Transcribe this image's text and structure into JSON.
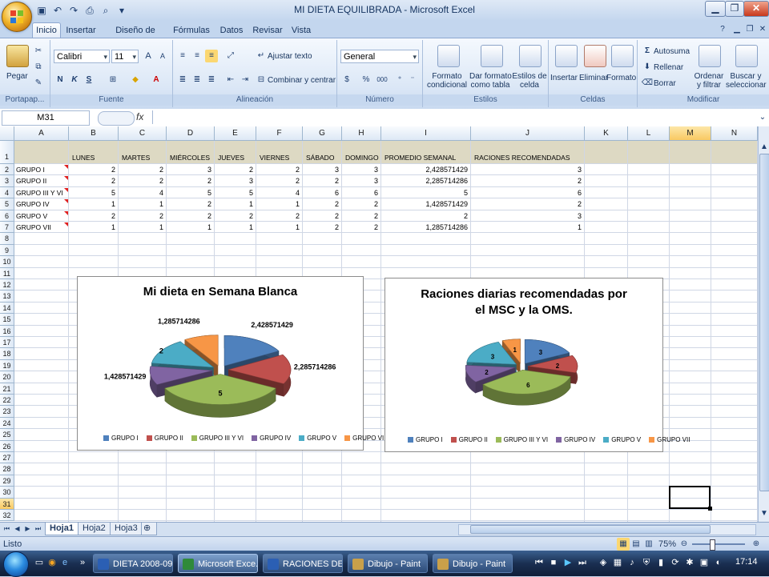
{
  "window": {
    "title": "MI DIETA EQUILIBRADA - Microsoft Excel",
    "controls": {
      "minimize": "▁",
      "maximize": "❐",
      "close": "✕"
    }
  },
  "ribbon_tabs": [
    "Inicio",
    "Insertar",
    "Diseño de página",
    "Fórmulas",
    "Datos",
    "Revisar",
    "Vista"
  ],
  "ribbon": {
    "clipboard": {
      "label": "Portapap...",
      "paste": "Pegar"
    },
    "font": {
      "label": "Fuente",
      "name": "Calibri",
      "size": "11",
      "bold": "N",
      "italic": "K",
      "underline": "S"
    },
    "alignment": {
      "label": "Alineación",
      "wrap": "Ajustar texto",
      "merge": "Combinar y centrar"
    },
    "number": {
      "label": "Número",
      "format": "General",
      "percent": "%",
      "thousands": "000"
    },
    "styles": {
      "label": "Estilos",
      "conditional": [
        "Formato",
        "condicional"
      ],
      "as_table": [
        "Dar formato",
        "como tabla"
      ],
      "cell_styles": [
        "Estilos de",
        "celda"
      ]
    },
    "cells": {
      "label": "Celdas",
      "insert": "Insertar",
      "delete": "Eliminar",
      "format": "Formato"
    },
    "editing": {
      "label": "Modificar",
      "autosum": "Autosuma",
      "fill": "Rellenar",
      "clear": "Borrar",
      "sort": [
        "Ordenar",
        "y filtrar"
      ],
      "find": [
        "Buscar y",
        "seleccionar"
      ]
    }
  },
  "formula_bar": {
    "name_box": "M31",
    "fx": "fx",
    "formula": ""
  },
  "columns": [
    "A",
    "B",
    "C",
    "D",
    "E",
    "F",
    "G",
    "H",
    "I",
    "J",
    "K",
    "L",
    "M",
    "N"
  ],
  "selected_column": "M",
  "selected_row": 31,
  "rows": [
    "1",
    "2",
    "3",
    "4",
    "5",
    "6",
    "7",
    "8",
    "9",
    "10",
    "11",
    "12",
    "13",
    "14",
    "15",
    "16",
    "17",
    "18",
    "19",
    "20",
    "21",
    "22",
    "23",
    "24",
    "25",
    "26",
    "27",
    "28",
    "29",
    "30",
    "31",
    "32"
  ],
  "table": {
    "headers": [
      "",
      "LUNES",
      "MARTES",
      "MIÉRCOLES",
      "JUEVES",
      "VIERNES",
      "SÁBADO",
      "DOMINGO",
      "PROMEDIO SEMANAL",
      "RACIONES RECOMENDADAS"
    ],
    "rows": [
      [
        "GRUPO I",
        "2",
        "2",
        "3",
        "2",
        "2",
        "3",
        "3",
        "2,428571429",
        "3"
      ],
      [
        "GRUPO II",
        "2",
        "2",
        "2",
        "3",
        "2",
        "2",
        "3",
        "2,285714286",
        "2"
      ],
      [
        "GRUPO III Y VI",
        "5",
        "4",
        "5",
        "5",
        "4",
        "6",
        "6",
        "5",
        "6"
      ],
      [
        "GRUPO IV",
        "1",
        "1",
        "2",
        "1",
        "1",
        "2",
        "2",
        "1,428571429",
        "2"
      ],
      [
        "GRUPO V",
        "2",
        "2",
        "2",
        "2",
        "2",
        "2",
        "2",
        "2",
        "3"
      ],
      [
        "GRUPO VII",
        "1",
        "1",
        "1",
        "1",
        "1",
        "2",
        "2",
        "1,285714286",
        "1"
      ]
    ]
  },
  "chart_data": [
    {
      "type": "pie",
      "title": "Mi dieta en Semana Blanca",
      "categories": [
        "GRUPO I",
        "GRUPO II",
        "GRUPO III Y VI",
        "GRUPO IV",
        "GRUPO V",
        "GRUPO VII"
      ],
      "values": [
        2.428571429,
        2.285714286,
        5,
        1.428571429,
        2,
        1.285714286
      ],
      "data_labels": [
        "2,428571429",
        "2,285714286",
        "5",
        "1,428571429",
        "2",
        "1,285714286"
      ],
      "colors": [
        "#4f81bd",
        "#c0504d",
        "#9bbb59",
        "#8064a2",
        "#4bacc6",
        "#f79646"
      ],
      "legend": "bottom",
      "exploded": true,
      "three_d": true
    },
    {
      "type": "pie",
      "title": "Raciones diarias recomendadas por el MSC y la OMS.",
      "categories": [
        "GRUPO I",
        "GRUPO II",
        "GRUPO III Y VI",
        "GRUPO IV",
        "GRUPO V",
        "GRUPO VII"
      ],
      "values": [
        3,
        2,
        6,
        2,
        3,
        1
      ],
      "data_labels": [
        "3",
        "2",
        "6",
        "2",
        "3",
        "1"
      ],
      "colors": [
        "#4f81bd",
        "#c0504d",
        "#9bbb59",
        "#8064a2",
        "#4bacc6",
        "#f79646"
      ],
      "legend": "bottom",
      "exploded": true,
      "three_d": true
    }
  ],
  "sheet_tabs": [
    "Hoja1",
    "Hoja2",
    "Hoja3"
  ],
  "active_sheet": "Hoja1",
  "status": {
    "text": "Listo",
    "zoom": "75%"
  },
  "taskbar": {
    "buttons": [
      "DIETA 2008-09...",
      "Microsoft Exce...",
      "RACIONES DE ...",
      "Dibujo - Paint",
      "Dibujo - Paint"
    ],
    "active": 1,
    "clock": "17:14",
    "overflow": "»"
  }
}
